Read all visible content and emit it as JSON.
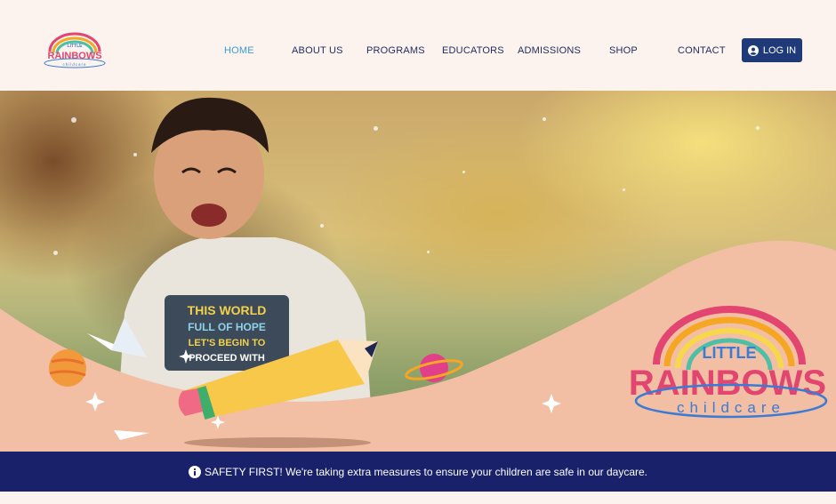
{
  "brand": {
    "logo_word_top": "LITTLE",
    "logo_word_main": "RAINBOWS",
    "logo_word_sub": "childcare"
  },
  "nav": {
    "items": [
      {
        "label": "HOME",
        "active": true
      },
      {
        "label": "ABOUT US",
        "active": false
      },
      {
        "label": "PROGRAMS",
        "active": false
      },
      {
        "label": "EDUCATORS",
        "active": false
      },
      {
        "label": "ADMISSIONS",
        "active": false
      },
      {
        "label": "SHOP",
        "active": false
      },
      {
        "label": "CONTACT",
        "active": false
      }
    ],
    "login_label": "LOG IN",
    "login_icon": "user-circle-icon"
  },
  "hero": {
    "shirt_text": [
      "THIS WORLD",
      "FULL OF HOPE",
      "LET'S BEGIN TO",
      "PROCEED WITH"
    ]
  },
  "notice": {
    "icon": "info-icon",
    "text": "SAFETY FIRST! We're taking extra measures to ensure your children are safe in our daycare."
  },
  "colors": {
    "accent": "#3a9ad9",
    "nav_text": "#1e2a5a",
    "button": "#1e3a78",
    "notice_bar": "#19216b",
    "wave": "#f2bea4",
    "page_bg": "#fdf3ee"
  }
}
